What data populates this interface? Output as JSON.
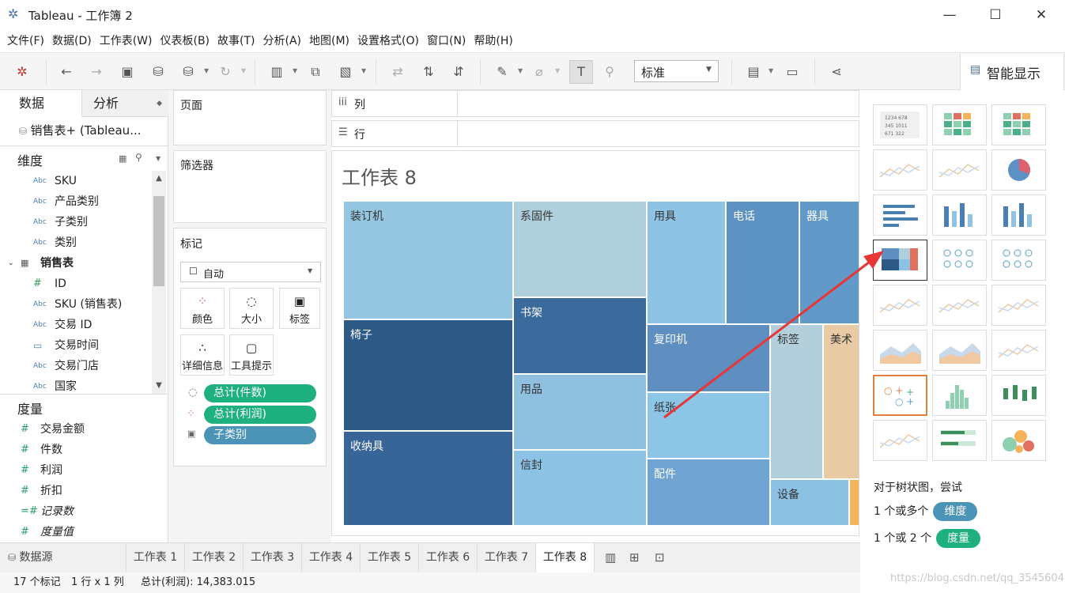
{
  "window": {
    "title": "Tableau - 工作簿 2"
  },
  "menu": [
    "文件(F)",
    "数据(D)",
    "工作表(W)",
    "仪表板(B)",
    "故事(T)",
    "分析(A)",
    "地图(M)",
    "设置格式(O)",
    "窗口(N)",
    "帮助(H)"
  ],
  "toolbar": {
    "fit_select": "标准",
    "smart_show_label": "智能显示"
  },
  "left_panel": {
    "tab_data": "数据",
    "tab_analysis": "分析",
    "datasource": "销售表+ (Tableau...",
    "dimensions_header": "维度",
    "dimensions": [
      {
        "icon": "Abc",
        "name": "SKU"
      },
      {
        "icon": "Abc",
        "name": "产品类别"
      },
      {
        "icon": "Abc",
        "name": "子类别"
      },
      {
        "icon": "Abc",
        "name": "类别"
      },
      {
        "icon": "table",
        "name": "销售表"
      },
      {
        "icon": "#",
        "name": "ID"
      },
      {
        "icon": "Abc",
        "name": "SKU (销售表)"
      },
      {
        "icon": "Abc",
        "name": "交易 ID"
      },
      {
        "icon": "date",
        "name": "交易时间"
      },
      {
        "icon": "Abc",
        "name": "交易门店"
      },
      {
        "icon": "Abc",
        "name": "国家"
      }
    ],
    "measures_header": "度量",
    "measures": [
      "交易金额",
      "件数",
      "利润",
      "折扣",
      "记录数",
      "度量值"
    ]
  },
  "shelves": {
    "pages": "页面",
    "filters": "筛选器",
    "marks": "标记",
    "mark_type": "自动",
    "mark_buttons": [
      "颜色",
      "大小",
      "标签",
      "详细信息",
      "工具提示"
    ],
    "pills": [
      "总计(件数)",
      "总计(利润)",
      "子类别"
    ],
    "columns": "列",
    "rows": "行"
  },
  "view": {
    "title": "工作表 8",
    "treemap": [
      {
        "label": "装订机",
        "color": "#94c6e1"
      },
      {
        "label": "椅子",
        "color": "#2c5985"
      },
      {
        "label": "收纳具",
        "color": "#376598"
      },
      {
        "label": "系固件",
        "color": "#b0cfdd"
      },
      {
        "label": "书架",
        "color": "#3b6a9c"
      },
      {
        "label": "用品",
        "color": "#8fc0e0"
      },
      {
        "label": "信封",
        "color": "#8cc3e5"
      },
      {
        "label": "用具",
        "color": "#8ec3e4"
      },
      {
        "label": "电话",
        "color": "#5b92c3"
      },
      {
        "label": "器具",
        "color": "#6199c9"
      },
      {
        "label": "复印机",
        "color": "#5e8fc0"
      },
      {
        "label": "纸张",
        "color": "#8cc5e6"
      },
      {
        "label": "配件",
        "color": "#6fa4d3"
      },
      {
        "label": "标签",
        "color": "#b3cfdc"
      },
      {
        "label": "美术",
        "color": "#e8cba5"
      },
      {
        "label": "设备",
        "color": "#8bc2e3"
      }
    ]
  },
  "show_me": {
    "hint_title": "对于树状图，尝试",
    "hint_dim_prefix": "1 个或多个",
    "hint_dim_chip": "维度",
    "hint_meas_prefix": "1 个或 2 个",
    "hint_meas_chip": "度量",
    "watermark": "https://blog.csdn.net/qq_35456045"
  },
  "sheet_tabs": {
    "datasource": "数据源",
    "tabs": [
      "工作表 1",
      "工作表 2",
      "工作表 3",
      "工作表 4",
      "工作表 5",
      "工作表 6",
      "工作表 7",
      "工作表 8"
    ]
  },
  "status": {
    "marks": "17 个标记",
    "rows_cols": "1 行 x 1 列",
    "sum": "总计(利润): 14,383.015"
  }
}
